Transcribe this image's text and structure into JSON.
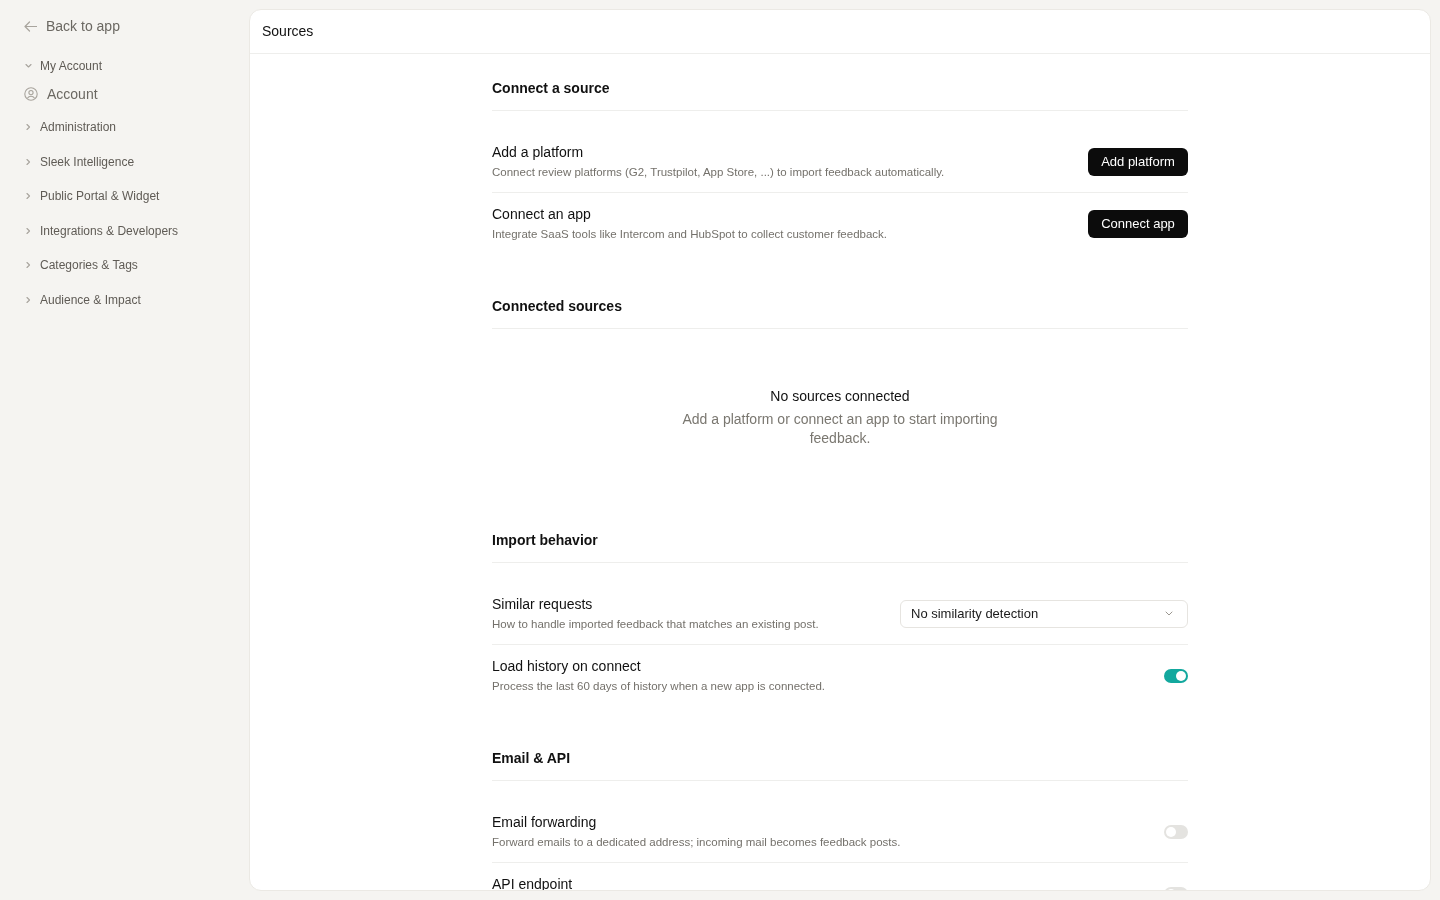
{
  "sidebar": {
    "back_link": "Back to app",
    "groups": [
      {
        "label": "My Account",
        "expanded": true,
        "children": [
          {
            "label": "Account"
          }
        ]
      },
      {
        "label": "Administration",
        "expanded": false
      },
      {
        "label": "Sleek Intelligence",
        "expanded": false
      },
      {
        "label": "Public Portal & Widget",
        "expanded": false
      },
      {
        "label": "Integrations & Developers",
        "expanded": false
      },
      {
        "label": "Categories & Tags",
        "expanded": false
      },
      {
        "label": "Audience & Impact",
        "expanded": false
      }
    ]
  },
  "page": {
    "title": "Sources",
    "sections": [
      {
        "heading": "Connect a source",
        "rows": [
          {
            "kind": "button",
            "title": "Add a platform",
            "description": "Connect review platforms (G2, Trustpilot, App Store, ...) to import feedback automatically.",
            "button": "Add platform"
          },
          {
            "kind": "button",
            "title": "Connect an app",
            "description": "Integrate SaaS tools like Intercom and HubSpot to collect customer feedback.",
            "button": "Connect app"
          }
        ]
      },
      {
        "heading": "Connected sources",
        "empty_state": {
          "title": "No sources connected",
          "message": "Add a platform or connect an app to start importing feedback."
        }
      },
      {
        "heading": "Import behavior",
        "rows": [
          {
            "kind": "select",
            "title": "Similar requests",
            "description": "How to handle imported feedback that matches an existing post.",
            "value": "No similarity detection"
          },
          {
            "kind": "toggle",
            "title": "Load history on connect",
            "description": "Process the last 60 days of history when a new app is connected.",
            "on": true
          }
        ]
      },
      {
        "heading": "Email & API",
        "rows": [
          {
            "kind": "toggle",
            "title": "Email forwarding",
            "description": "Forward emails to a dedicated address; incoming mail becomes feedback posts.",
            "on": false
          },
          {
            "kind": "toggle",
            "title": "API endpoint",
            "on": false
          }
        ]
      }
    ]
  }
}
